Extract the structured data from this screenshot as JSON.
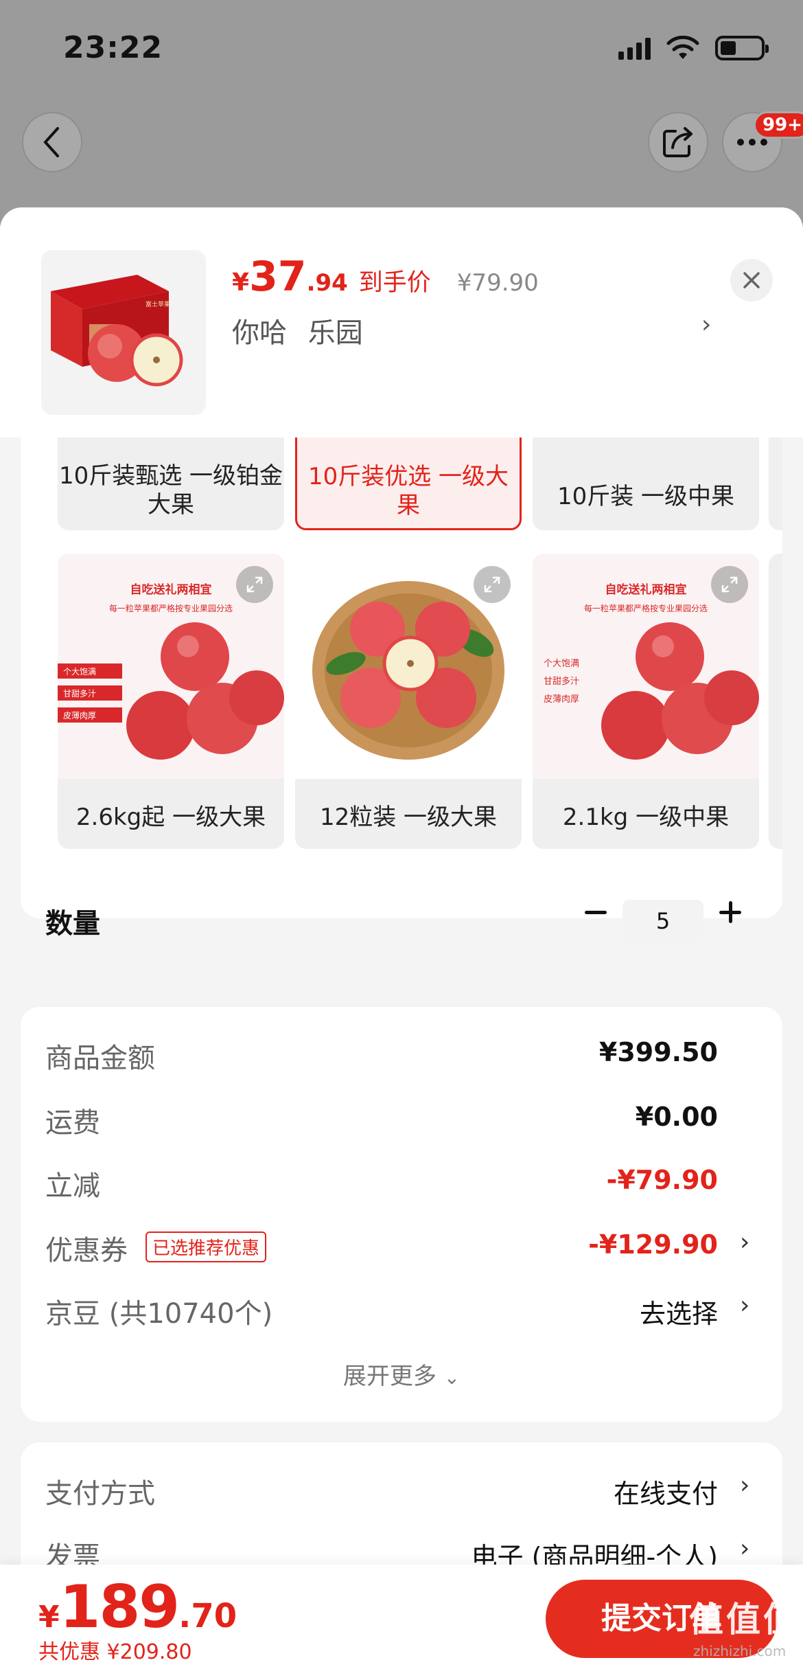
{
  "status": {
    "time": "23:22"
  },
  "nav": {
    "badge": "99+"
  },
  "header": {
    "price_symbol": "¥",
    "price_int": "37",
    "price_dec": ".94",
    "price_tag": "到手价",
    "original_price": "¥79.90",
    "spec": "你哈 乐园"
  },
  "options": [
    {
      "label": "10斤装甄选 一级铂金大果",
      "selected": false
    },
    {
      "label": "10斤装优选 一级大果",
      "selected": true
    },
    {
      "label": "10斤装 一级中果",
      "selected": false
    },
    {
      "label": "2.6kg起 一级大果",
      "selected": false
    },
    {
      "label": "12粒装 一级大果",
      "selected": false
    },
    {
      "label": "2.1kg 一级中果",
      "selected": false
    }
  ],
  "promo": {
    "title": "自吃送礼两相宜",
    "subtitle": "每一粒苹果都严格按专业果园分选",
    "tags": [
      "个大饱满",
      "甘甜多汁",
      "皮薄肉厚"
    ]
  },
  "box_logo": "富士苹果",
  "quantity": {
    "label": "数量",
    "value": "5"
  },
  "summary": {
    "goods_label": "商品金额",
    "goods_value": "¥399.50",
    "shipping_label": "运费",
    "shipping_value": "¥0.00",
    "discount_label": "立减",
    "discount_value": "-¥79.90",
    "coupon_label": "优惠券",
    "coupon_tag": "已选推荐优惠",
    "coupon_value": "-¥129.90",
    "beans_label": "京豆 (共10740个)",
    "beans_value": "去选择",
    "expand": "展开更多"
  },
  "payment": {
    "method_label": "支付方式",
    "method_value": "在线支付",
    "invoice_label": "发票",
    "invoice_value": "电子 (商品明细-个人)"
  },
  "footer": {
    "total_symbol": "¥",
    "total_int": "189",
    "total_dec": ".70",
    "saved": "共优惠 ¥209.80",
    "submit": "提交订单"
  },
  "watermark": {
    "main": "值值值",
    "sub": "zhizhizhi.com"
  },
  "colors": {
    "accent": "#e2231a",
    "button": "#e52d1f"
  }
}
